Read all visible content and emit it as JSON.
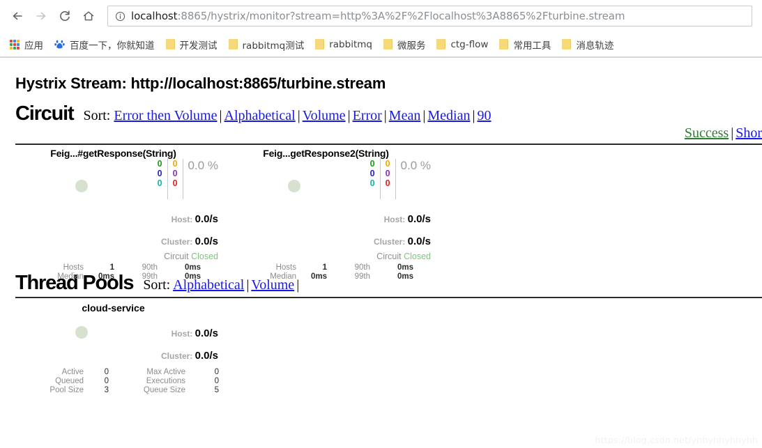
{
  "browser": {
    "nav": {
      "back": "back-arrow",
      "forward": "forward-arrow",
      "reload": "reload",
      "home": "home"
    },
    "omnibox": {
      "site_info_icon": "info-circle-icon",
      "host": "localhost",
      "path": ":8865/hystrix/monitor?stream=http%3A%2F%2Flocalhost%3A8865%2Fturbine.stream",
      "full_url": "localhost:8865/hystrix/monitor?stream=http%3A%2F%2Flocalhost%3A8865%2Fturbine.stream"
    },
    "bookmarks": [
      {
        "label": "应用",
        "icon": "apps-grid-icon"
      },
      {
        "label": "百度一下，你就知道",
        "icon": "baidu-icon"
      },
      {
        "label": "开发测试",
        "icon": "folder-icon"
      },
      {
        "label": "rabbitmq测试",
        "icon": "folder-icon"
      },
      {
        "label": "rabbitmq",
        "icon": "folder-icon"
      },
      {
        "label": "微服务",
        "icon": "folder-icon"
      },
      {
        "label": "ctg-flow",
        "icon": "folder-icon"
      },
      {
        "label": "常用工具",
        "icon": "folder-icon"
      },
      {
        "label": "消息轨迹",
        "icon": "folder-icon"
      }
    ]
  },
  "page": {
    "stream_title": "Hystrix Stream: http://localhost:8865/turbine.stream",
    "watermark": "https://blog.csdn.net/yhhyhhyhhyhh",
    "circuit": {
      "title": "Circuit",
      "sort_label": "Sort:",
      "sort_links_row1": [
        "Error then Volume",
        "Alphabetical",
        "Volume",
        "Error",
        "Mean",
        "Median",
        "90"
      ],
      "sort_links_row2": [
        "Success",
        "Shor"
      ],
      "cards": [
        {
          "name": "Feig...#getResponse(String)",
          "counters": {
            "success": "0",
            "short_circuited": "0",
            "bad_request": "0",
            "timeout": "0",
            "rejected": "0",
            "failure": "0"
          },
          "error_percent": "0.0 %",
          "host_label": "Host:",
          "host_rate": "0.0/s",
          "cluster_label": "Cluster:",
          "cluster_rate": "0.0/s",
          "circuit_label": "Circuit",
          "circuit_state": "Closed",
          "stats": [
            {
              "k": "Hosts",
              "v": "1",
              "k2": "90th",
              "v2": "0ms"
            },
            {
              "k": "Median",
              "v": "0ms",
              "k2": "99th",
              "v2": "0ms"
            }
          ]
        },
        {
          "name": "Feig...getResponse2(String)",
          "counters": {
            "success": "0",
            "short_circuited": "0",
            "bad_request": "0",
            "timeout": "0",
            "rejected": "0",
            "failure": "0"
          },
          "error_percent": "0.0 %",
          "host_label": "Host:",
          "host_rate": "0.0/s",
          "cluster_label": "Cluster:",
          "cluster_rate": "0.0/s",
          "circuit_label": "Circuit",
          "circuit_state": "Closed",
          "stats": [
            {
              "k": "Hosts",
              "v": "1",
              "k2": "90th",
              "v2": "0ms"
            },
            {
              "k": "Median",
              "v": "0ms",
              "k2": "99th",
              "v2": "0ms"
            }
          ]
        }
      ]
    },
    "thread_pools": {
      "title": "Thread Pools",
      "sort_label": "Sort:",
      "sort_links": [
        "Alphabetical",
        "Volume"
      ],
      "cards": [
        {
          "name": "cloud-service",
          "host_label": "Host:",
          "host_rate": "0.0/s",
          "cluster_label": "Cluster:",
          "cluster_rate": "0.0/s",
          "stats": [
            {
              "k": "Active",
              "v": "0",
              "k2": "Max Active",
              "v2": "0"
            },
            {
              "k": "Queued",
              "v": "0",
              "k2": "Executions",
              "v2": "0"
            },
            {
              "k": "Pool Size",
              "v": "3",
              "k2": "Queue Size",
              "v2": "5"
            }
          ]
        }
      ]
    }
  },
  "colors": {
    "link": "#1a1ae6",
    "success_green": "#2f7d32",
    "closed_green": "#7cc47f",
    "counter_success": "#1a9c1a",
    "counter_short_circuited": "#2222cc",
    "counter_bad_request": "#11b5a8",
    "counter_timeout": "#f0a800",
    "counter_rejected": "#8b2fbd",
    "counter_failure": "#e02020",
    "dot": "#cfdcc7",
    "folder": "#f5d97a"
  }
}
